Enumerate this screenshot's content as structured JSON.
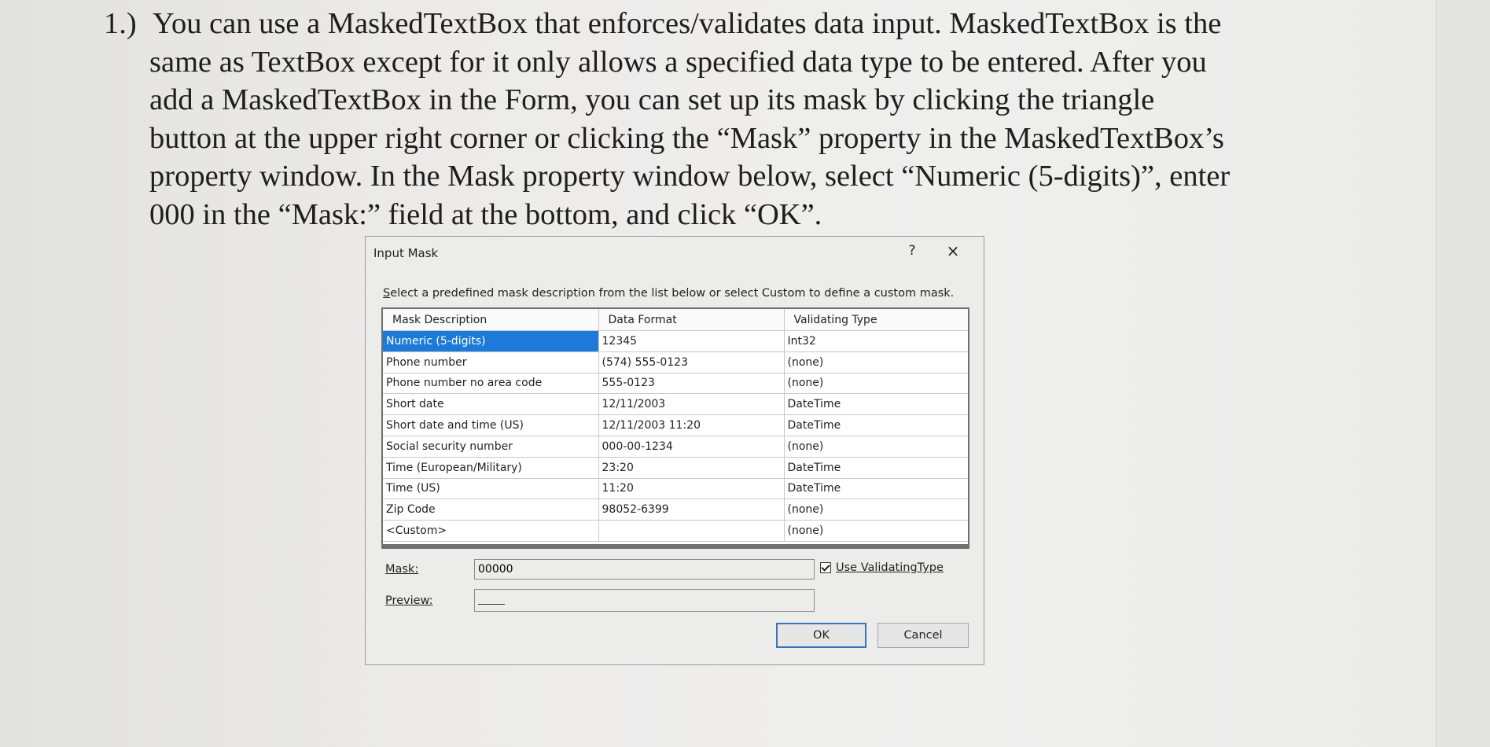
{
  "instructions": {
    "number": "1.)",
    "lines": [
      "You can use a MaskedTextBox that enforces/validates data input. MaskedTextBox is the",
      "same as TextBox except for it only allows a specified data type to be entered. After you",
      "add a MaskedTextBox in the Form, you can set up its mask by clicking the triangle",
      "button at the upper right corner or clicking the “Mask” property in the MaskedTextBox’s",
      "property window. In the Mask property window below, select “Numeric (5-digits)”, enter",
      "000 in the “Mask:” field at the bottom, and click “OK”."
    ]
  },
  "dialog": {
    "title": "Input Mask",
    "help_glyph": "?",
    "close_glyph": "×",
    "instruction_first_letter": "S",
    "instruction_rest": "elect a predefined mask description from the list below or select Custom to define a custom mask.",
    "columns": [
      "Mask Description",
      "Data Format",
      "Validating Type"
    ],
    "rows": [
      {
        "desc": "Numeric (5-digits)",
        "format": "12345",
        "type": "Int32",
        "selected": true
      },
      {
        "desc": "Phone number",
        "format": "(574) 555-0123",
        "type": "(none)"
      },
      {
        "desc": "Phone number no area code",
        "format": "555-0123",
        "type": "(none)"
      },
      {
        "desc": "Short date",
        "format": "12/11/2003",
        "type": "DateTime"
      },
      {
        "desc": "Short date and time (US)",
        "format": "12/11/2003 11:20",
        "type": "DateTime"
      },
      {
        "desc": "Social security number",
        "format": "000-00-1234",
        "type": "(none)"
      },
      {
        "desc": "Time (European/Military)",
        "format": "23:20",
        "type": "DateTime"
      },
      {
        "desc": "Time (US)",
        "format": "11:20",
        "type": "DateTime"
      },
      {
        "desc": "Zip Code",
        "format": "98052-6399",
        "type": "(none)"
      },
      {
        "desc": "<Custom>",
        "format": "",
        "type": "(none)"
      }
    ],
    "mask_label": "Mask:",
    "mask_value": "00000",
    "use_validating_type_label": "Use ValidatingType",
    "use_validating_type_checked": true,
    "preview_label": "Preview:",
    "ok_label": "OK",
    "cancel_label": "Cancel",
    "accent_color": "#1e7ad8"
  }
}
